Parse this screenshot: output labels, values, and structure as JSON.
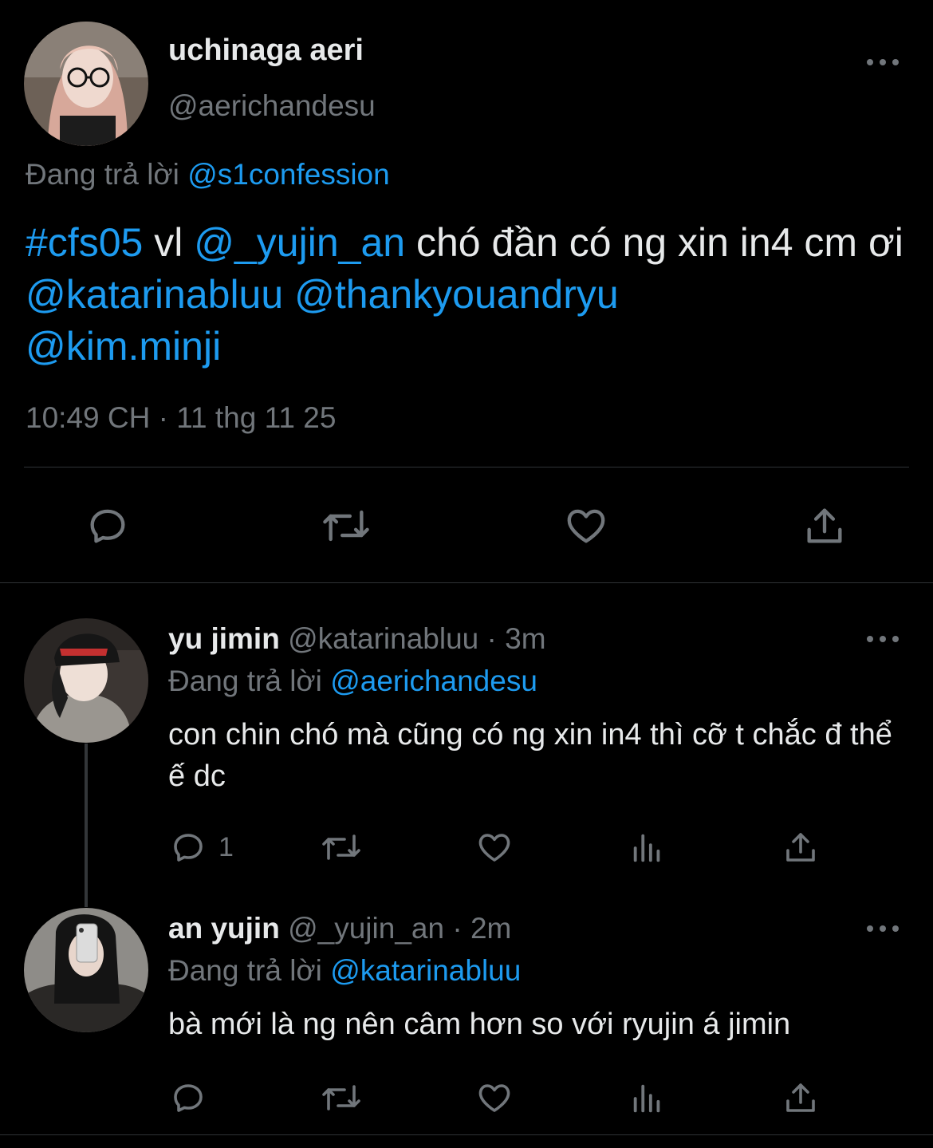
{
  "main_tweet": {
    "display_name": "uchinaga aeri",
    "handle": "@aerichandesu",
    "replying_prefix": "Đang trả lời",
    "replying_to": "@s1confession",
    "segments": {
      "hashtag": "#cfs05",
      "t1": " vl ",
      "m1": "@_yujin_an",
      "t2": " chó đần có ng xin in4 cm ơi ",
      "m2": "@katarinabluu",
      "t3": " ",
      "m3": "@thankyouandryu",
      "t4": " ",
      "m4": "@kim.minji"
    },
    "timestamp": "10:49 CH · 11 thg 11 25",
    "actions": [
      "reply-icon",
      "retweet-icon",
      "like-icon",
      "share-icon"
    ]
  },
  "replies": [
    {
      "display_name": "yu jimin",
      "handle": "@katarinabluu",
      "time": "· 3m",
      "replying_prefix": "Đang trả lời",
      "replying_to": "@aerichandesu",
      "text": "con chin chó mà cũng có ng xin in4 thì cỡ t chắc đ thể ế dc",
      "reply_count": "1"
    },
    {
      "display_name": "an yujin",
      "handle": "@_yujin_an",
      "time": "· 2m",
      "replying_prefix": "Đang trả lời",
      "replying_to": "@katarinabluu",
      "text": "bà mới là ng nên câm hơn so với ryujin á jimin",
      "reply_count": ""
    }
  ],
  "colors": {
    "background": "#000000",
    "accent": "#1d9bf0",
    "muted": "#71767b",
    "text": "#e7e9ea"
  }
}
